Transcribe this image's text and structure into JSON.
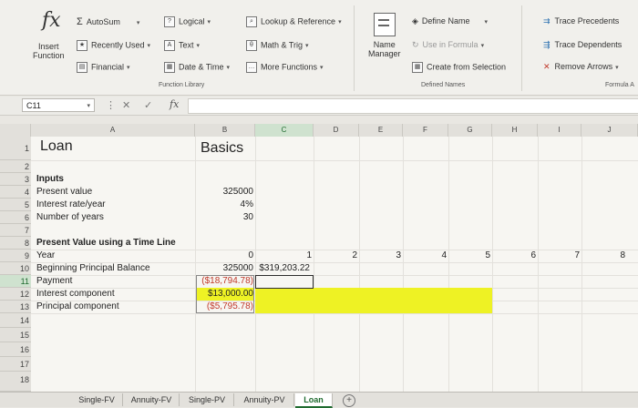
{
  "ribbon": {
    "insert_function": "Insert\nFunction",
    "autosum": "AutoSum",
    "recently_used": "Recently Used",
    "financial": "Financial",
    "logical": "Logical",
    "text": "Text",
    "date_time": "Date & Time",
    "lookup_reference": "Lookup & Reference",
    "math_trig": "Math & Trig",
    "more_functions": "More Functions",
    "function_library_label": "Function Library",
    "name_manager": "Name\nManager",
    "define_name": "Define Name",
    "use_in_formula": "Use in Formula",
    "create_from_selection": "Create from Selection",
    "defined_names_label": "Defined Names",
    "trace_precedents": "Trace Precedents",
    "trace_dependents": "Trace Dependents",
    "remove_arrows": "Remove Arrows",
    "formula_auditing_label": "Formula A"
  },
  "formula_bar": {
    "name_box": "C11",
    "formula": ""
  },
  "columns": [
    "A",
    "B",
    "C",
    "D",
    "E",
    "F",
    "G",
    "H",
    "I",
    "J"
  ],
  "rows": [
    "1",
    "2",
    "3",
    "4",
    "5",
    "6",
    "7",
    "8",
    "9",
    "10",
    "11",
    "12",
    "13",
    "14",
    "15",
    "16",
    "17",
    "18"
  ],
  "cells": {
    "A1": "Loan",
    "B1": "Basics",
    "A3": "Inputs",
    "A4": "Present value",
    "A5": "Interest rate/year",
    "A6": "Number of years",
    "B4": "325000",
    "B5": "4%",
    "B6": "30",
    "A8": "Present Value using a Time Line",
    "A9": "Year",
    "B9": "0",
    "C9": "1",
    "D9": "2",
    "E9": "3",
    "F9": "4",
    "G9": "5",
    "H9": "6",
    "I9": "7",
    "J9": "8",
    "A10": "Beginning Principal Balance",
    "B10": "325000",
    "C10": "$319,203.22",
    "A11": "Payment",
    "B11": "($18,794.78)",
    "A12": "Interest component",
    "B12": "$13,000.00",
    "A13": "Principal component",
    "B13": "($5,795.78)"
  },
  "sheet_tabs": [
    "Single-FV",
    "Annuity-FV",
    "Single-PV",
    "Annuity-PV",
    "Loan"
  ],
  "active_tab": "Loan",
  "colors": {
    "highlight": "#eef224",
    "negative": "#c0392b",
    "excel_green": "#1f6b2f"
  }
}
